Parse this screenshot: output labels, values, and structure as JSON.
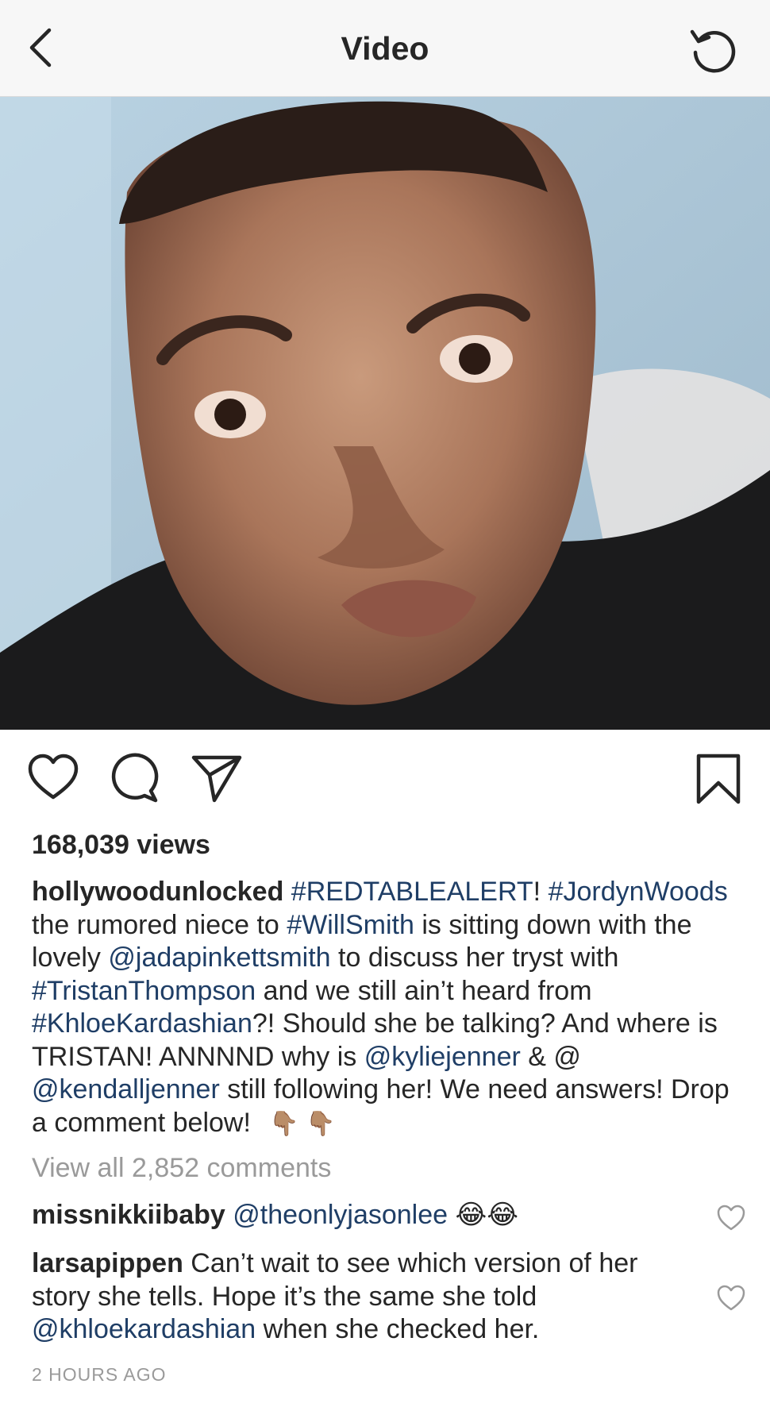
{
  "nav": {
    "title": "Video",
    "back_icon": "chevron-left-icon",
    "refresh_icon": "refresh-icon"
  },
  "video": {
    "icon": "video-player"
  },
  "actions": {
    "like_icon": "heart-outline-icon",
    "comment_icon": "comment-bubble-icon",
    "share_icon": "paper-plane-icon",
    "save_icon": "bookmark-icon"
  },
  "views": "168,039 views",
  "caption": {
    "username": "hollywoodunlocked",
    "parts": [
      " ",
      "#REDTABLEALERT",
      "! ",
      "#JordynWoods",
      " the rumored niece to ",
      "#WillSmith",
      " is sitting down with the lovely ",
      "@jadapinkettsmith",
      " to discuss her tryst with ",
      "#TristanThompson",
      " and we still ain’t heard from ",
      "#KhloeKardashian",
      "?! Should she be talking? And where is TRISTAN! ANNNND why is ",
      "@kyliejenner",
      " & @ ",
      "@kendalljenner",
      " still following her! We need answers! Drop a comment below! "
    ],
    "emoji": "👇🏽 👇🏽"
  },
  "view_all_comments": "View all 2,852 comments",
  "comments": [
    {
      "username": "missnikkiibaby",
      "mention": "@theonlyjasonlee",
      "emoji": "😂😂"
    },
    {
      "username": "larsapippen",
      "text": "Can’t wait to see which version of her story she tells. Hope it’s the same she told ",
      "mention": "@khloekardashian",
      "text2": " when she checked her."
    }
  ],
  "timestamp": "2 HOURS AGO",
  "colors": {
    "link": "#1f3e66",
    "muted": "#9a9a9a",
    "text": "#262626",
    "navbar": "#f7f7f7"
  }
}
